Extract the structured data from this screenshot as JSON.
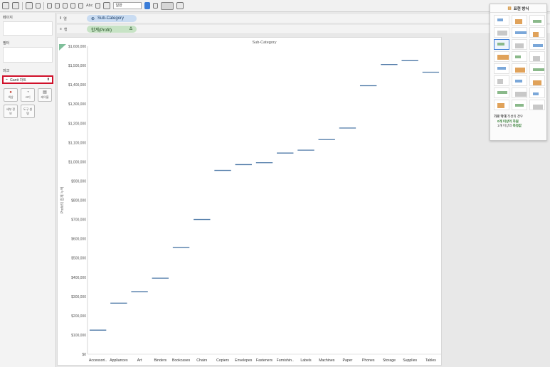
{
  "toolbar": {
    "text_label": "Abc",
    "fit_select": "일반"
  },
  "panels": {
    "pages_title": "페이지",
    "filters_title": "필터",
    "marks_title": "마크",
    "marks_type": "Gantt 차트",
    "mark_buttons": [
      {
        "label": "색상",
        "icon": "color-icon"
      },
      {
        "label": "크기",
        "icon": "size-icon"
      },
      {
        "label": "레이블",
        "icon": "label-icon"
      },
      {
        "label": "세부 정보",
        "icon": "detail-icon"
      },
      {
        "label": "도구 설명",
        "icon": "tooltip-icon"
      }
    ]
  },
  "shelves": {
    "columns_label": "열",
    "columns_pill": "Sub-Category",
    "rows_label": "행",
    "rows_pill": "합계(Profit)",
    "rows_pill_delta": "Δ"
  },
  "showme": {
    "title": "표현 방식",
    "hint_line1_a": "가로 막대",
    "hint_line1_b": "작성의 경우",
    "hint_line2": "0개 이상의 차원",
    "hint_line3_a": "1개 이상의",
    "hint_line3_b": "측정값"
  },
  "chart_data": {
    "type": "gantt",
    "title": "Sub-Category",
    "xlabel": "",
    "ylabel": "Profit의 합계 누적",
    "ylim": [
      0,
      1600000
    ],
    "yticks": [
      0,
      100000,
      200000,
      300000,
      400000,
      500000,
      600000,
      700000,
      800000,
      900000,
      1000000,
      1100000,
      1200000,
      1300000,
      1400000,
      1500000,
      1600000
    ],
    "ytick_labels": [
      "$0",
      "$100,000",
      "$200,000",
      "$300,000",
      "$400,000",
      "$500,000",
      "$600,000",
      "$700,000",
      "$800,000",
      "$900,000",
      "$1,000,000",
      "$1,100,000",
      "$1,200,000",
      "$1,300,000",
      "$1,400,000",
      "$1,500,000",
      "$1,600,000"
    ],
    "categories": [
      "Accessori..",
      "Appliances",
      "Art",
      "Binders",
      "Bookcases",
      "Chairs",
      "Copiers",
      "Envelopes",
      "Fasteners",
      "Furnishin..",
      "Labels",
      "Machines",
      "Paper",
      "Phones",
      "Storage",
      "Supplies",
      "Tables"
    ],
    "values": [
      125000,
      265000,
      325000,
      395000,
      555000,
      700000,
      955000,
      985000,
      995000,
      1045000,
      1060000,
      1115000,
      1175000,
      1395000,
      1505000,
      1525000,
      1465000
    ],
    "grid": false,
    "mark_color": "#4e79a7"
  }
}
